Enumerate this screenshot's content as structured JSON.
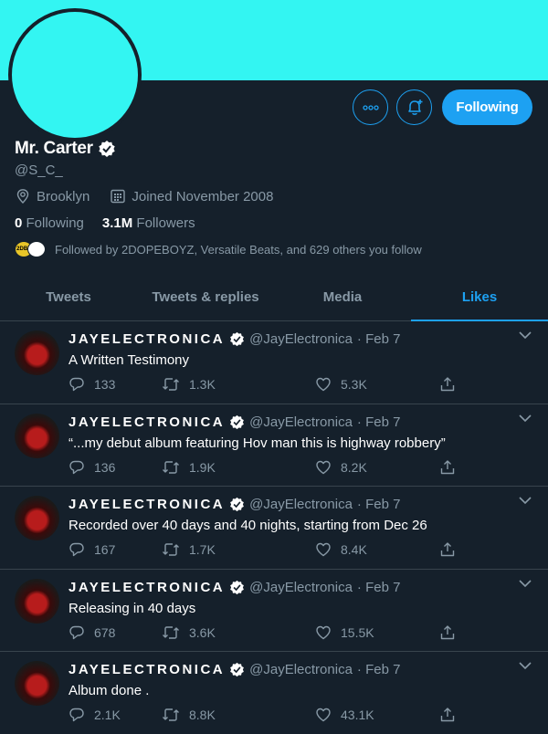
{
  "colors": {
    "banner": "#33f5f2",
    "background": "#15202b",
    "accent": "#1da1f2",
    "muted": "#8899a6",
    "border": "#38444d"
  },
  "profile": {
    "name": "Mr. Carter",
    "handle": "@S_C_",
    "location": "Brooklyn",
    "joined": "Joined November 2008",
    "following_count": "0",
    "following_label": "Following",
    "followers_count": "3.1M",
    "followers_label": "Followers",
    "followed_by": "Followed by 2DOPEBOYZ, Versatile Beats, and 629 others you follow",
    "mini_avatar_text": "2DBZ"
  },
  "actions": {
    "follow_label": "Following",
    "more_icon": "more-icon",
    "notify_icon": "bell-plus-icon"
  },
  "tabs": [
    {
      "label": "Tweets"
    },
    {
      "label": "Tweets & replies"
    },
    {
      "label": "Media"
    },
    {
      "label": "Likes",
      "active": true
    }
  ],
  "tweets": [
    {
      "name": "JAYELECTRONICA",
      "handle": "@JayElectronica",
      "date": "· Feb 7",
      "text": "A Written Testimony",
      "replies": "133",
      "retweets": "1.3K",
      "likes": "5.3K"
    },
    {
      "name": "JAYELECTRONICA",
      "handle": "@JayElectronica",
      "date": "· Feb 7",
      "text": "“...my debut album featuring Hov man this is highway robbery”",
      "replies": "136",
      "retweets": "1.9K",
      "likes": "8.2K"
    },
    {
      "name": "JAYELECTRONICA",
      "handle": "@JayElectronica",
      "date": "· Feb 7",
      "text": "Recorded over 40 days and 40 nights, starting from Dec 26",
      "replies": "167",
      "retweets": "1.7K",
      "likes": "8.4K"
    },
    {
      "name": "JAYELECTRONICA",
      "handle": "@JayElectronica",
      "date": "· Feb 7",
      "text": "Releasing in 40 days",
      "replies": "678",
      "retweets": "3.6K",
      "likes": "15.5K"
    },
    {
      "name": "JAYELECTRONICA",
      "handle": "@JayElectronica",
      "date": "· Feb 7",
      "text": "Album done .",
      "replies": "2.1K",
      "retweets": "8.8K",
      "likes": "43.1K"
    }
  ]
}
